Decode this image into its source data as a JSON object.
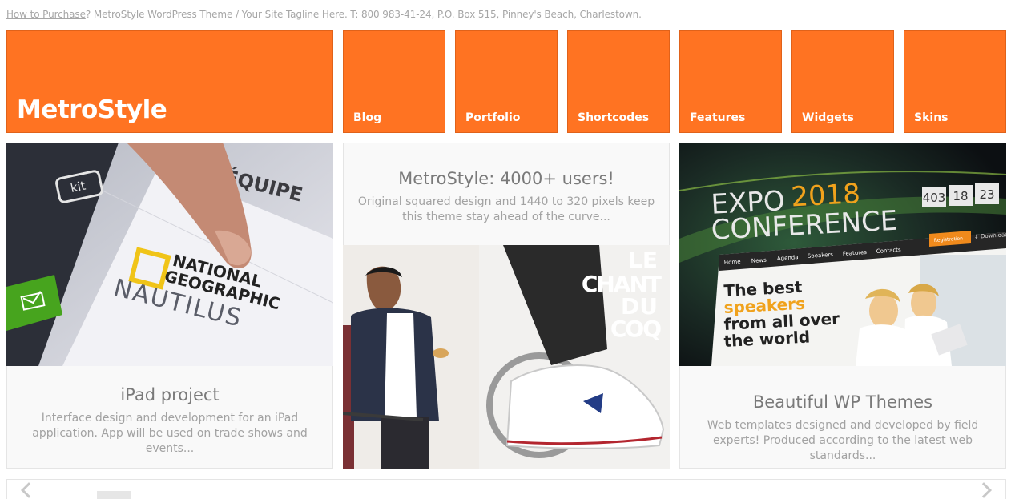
{
  "topbar": {
    "purchase_link": "How to Purchase",
    "after_link": "? MetroStyle WordPress Theme / Your Site Tagline Here. T: 800 983-41-24, P.O. Box 515, Pinney's Beach, Charlestown."
  },
  "brand": {
    "name": "MetroStyle",
    "color": "#ff7322"
  },
  "nav": [
    {
      "label": "Blog"
    },
    {
      "label": "Portfolio"
    },
    {
      "label": "Shortcodes"
    },
    {
      "label": "Features"
    },
    {
      "label": "Widgets"
    },
    {
      "label": "Skins"
    }
  ],
  "cards": {
    "ipad": {
      "title": "iPad project",
      "description": "Interface design and development for an iPad application. App will be used on trade shows and events...",
      "image_text": {
        "kit": "kit",
        "equipe": "ÉQUIPE",
        "ng1": "NATIONAL",
        "ng2": "GEOGRAPHIC",
        "nautilus": "NAUTILUS"
      }
    },
    "metro": {
      "title": "MetroStyle: 4000+ users!",
      "description": "Original squared design and 1440 to 320 pixels keep this theme stay ahead of the curve...",
      "image_text": {
        "l1": "LE",
        "l2": "CHANT",
        "l3": "DU",
        "l4": "COQ"
      }
    },
    "wp": {
      "title": "Beautiful WP Themes",
      "description": "Web templates designed and developed by field experts! Produced according to the latest web standards...",
      "image_text": {
        "expo": "EXPO",
        "year": "2018",
        "conference": "CONFERENCE",
        "d1": "403",
        "d2": "18",
        "d3": "23",
        "menu": [
          "Home",
          "News",
          "Agenda",
          "Speakers",
          "Features",
          "Contacts"
        ],
        "reg": "Registration",
        "dl": "↓ Download",
        "h1": "The best",
        "h2": "speakers",
        "h3": "from all over",
        "h4": "the world"
      }
    }
  }
}
